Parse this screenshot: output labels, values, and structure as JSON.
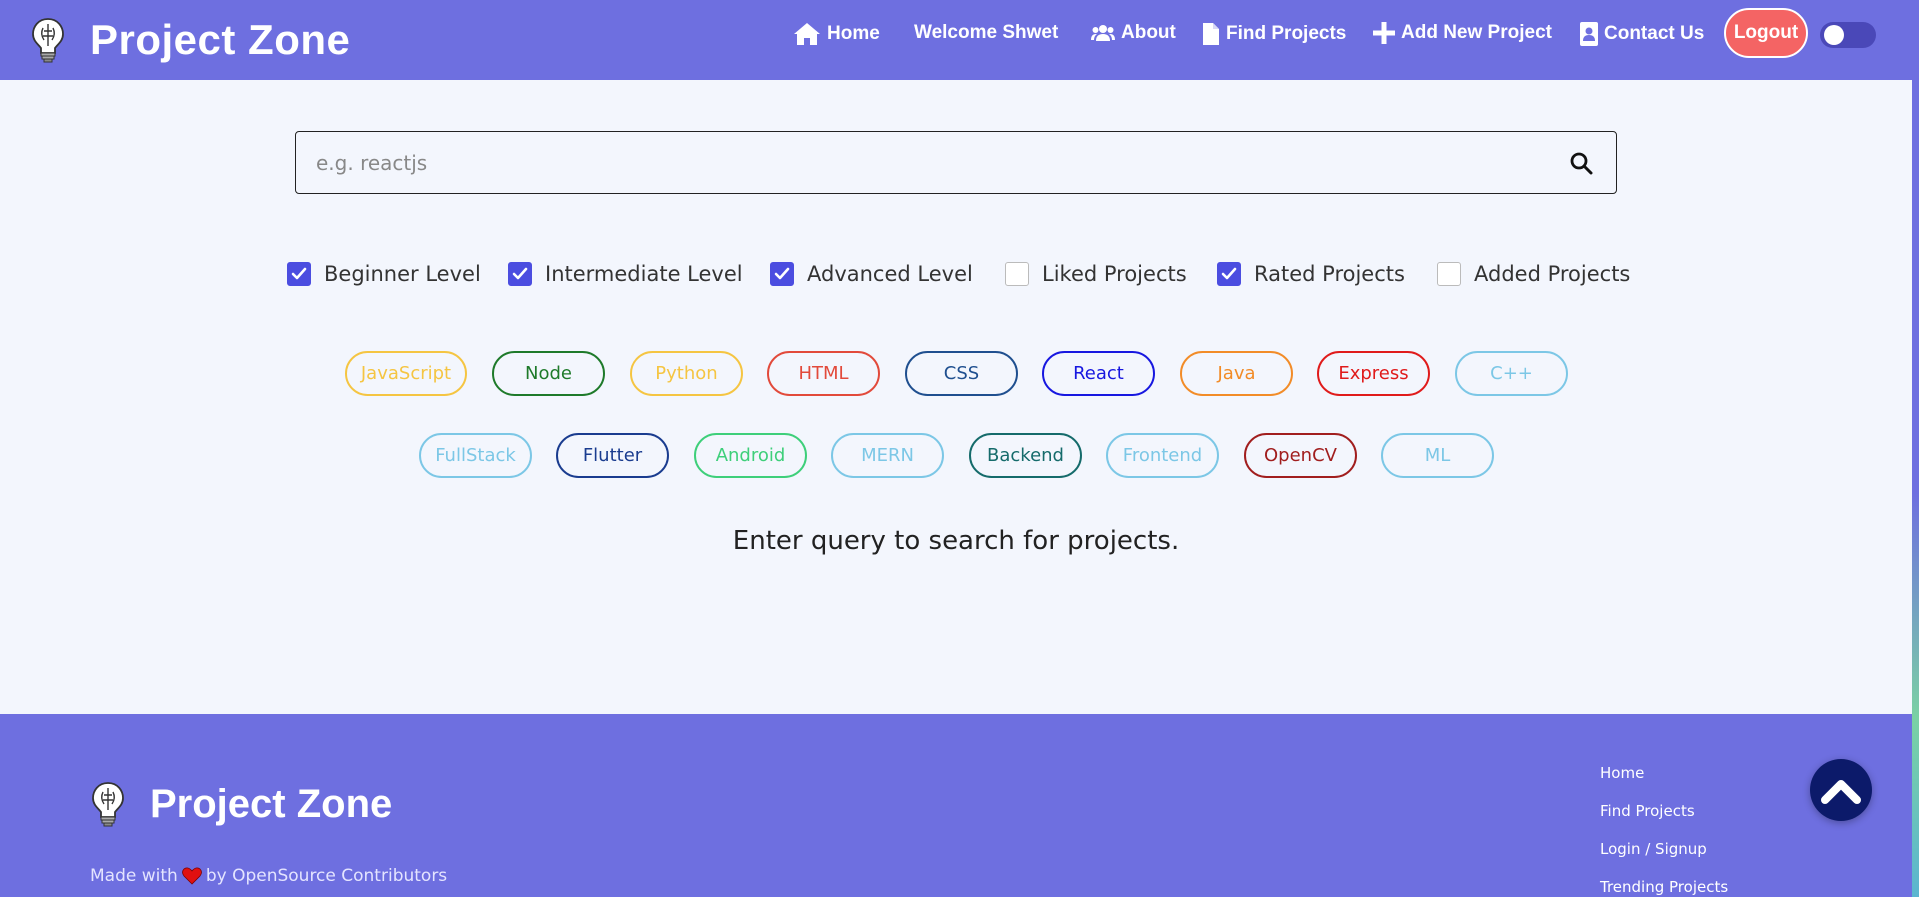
{
  "navbar": {
    "title": "Project Zone",
    "links": {
      "home": "Home",
      "welcome": "Welcome Shwet",
      "about": "About",
      "find_projects": "Find Projects",
      "add_project": "Add New Project",
      "contact": "Contact Us"
    },
    "logout": "Logout",
    "theme_toggle_on": false
  },
  "search": {
    "placeholder": "e.g. reactjs",
    "value": ""
  },
  "filters": [
    {
      "label": "Beginner Level",
      "checked": true
    },
    {
      "label": "Intermediate Level",
      "checked": true
    },
    {
      "label": "Advanced Level",
      "checked": true
    },
    {
      "label": "Liked Projects",
      "checked": false
    },
    {
      "label": "Rated Projects",
      "checked": true
    },
    {
      "label": "Added Projects",
      "checked": false
    }
  ],
  "tags_row1": [
    {
      "label": "JavaScript",
      "color": "#f5c542"
    },
    {
      "label": "Node",
      "color": "#1e7a2a"
    },
    {
      "label": "Python",
      "color": "#f5c542"
    },
    {
      "label": "HTML",
      "color": "#e24a3b"
    },
    {
      "label": "CSS",
      "color": "#1f4f8f"
    },
    {
      "label": "React",
      "color": "#1717e0"
    },
    {
      "label": "Java",
      "color": "#f28c28"
    },
    {
      "label": "Express",
      "color": "#e01b1b"
    },
    {
      "label": "C++",
      "color": "#7cc7e6"
    }
  ],
  "tags_row2": [
    {
      "label": "FullStack",
      "color": "#7cc7e6"
    },
    {
      "label": "Flutter",
      "color": "#1a3c8f"
    },
    {
      "label": "Android",
      "color": "#3ecf7a"
    },
    {
      "label": "MERN",
      "color": "#7cc7e6"
    },
    {
      "label": "Backend",
      "color": "#156b6b"
    },
    {
      "label": "Frontend",
      "color": "#7cc7e6"
    },
    {
      "label": "OpenCV",
      "color": "#a11e1e"
    },
    {
      "label": "ML",
      "color": "#7cc7e6"
    }
  ],
  "empty_message": "Enter query to search for projects.",
  "footer": {
    "title": "Project Zone",
    "made_with_prefix": "Made with",
    "made_with_suffix": "by OpenSource Contributors",
    "links": [
      "Home",
      "Find Projects",
      "Login / Signup",
      "Trending Projects"
    ]
  },
  "colors": {
    "primary": "#6e6fe0",
    "checkbox": "#4b4de0",
    "logout": "#f46464",
    "scroll_top": "#0c1a6a"
  }
}
